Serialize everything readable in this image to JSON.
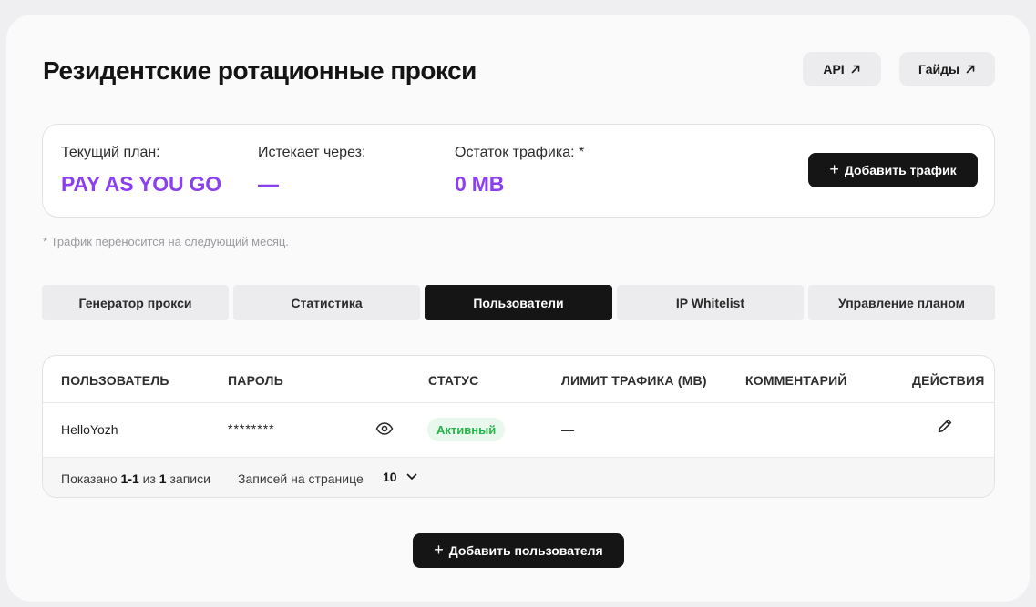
{
  "page": {
    "title": "Резидентские ротационные прокси"
  },
  "header": {
    "api_label": "API",
    "guides_label": "Гайды"
  },
  "plan": {
    "current_label": "Текущий план:",
    "current_value": "PAY AS YOU GO",
    "expires_label": "Истекает через:",
    "expires_value": "—",
    "traffic_label": "Остаток трафика: *",
    "traffic_value": "0 MB",
    "add_traffic_label": "Добавить трафик",
    "footnote": "* Трафик переносится на следующий месяц."
  },
  "tabs": [
    {
      "label": "Генератор прокси",
      "active": false
    },
    {
      "label": "Статистика",
      "active": false
    },
    {
      "label": "Пользователи",
      "active": true
    },
    {
      "label": "IP Whitelist",
      "active": false
    },
    {
      "label": "Управление планом",
      "active": false
    }
  ],
  "table": {
    "columns": [
      "ПОЛЬЗОВАТЕЛЬ",
      "ПАРОЛЬ",
      "СТАТУС",
      "ЛИМИТ ТРАФИКА (MB)",
      "КОММЕНТАРИЙ",
      "ДЕЙСТВИЯ"
    ],
    "rows": [
      {
        "user": "HelloYozh",
        "password": "********",
        "status": "Активный",
        "limit": "—",
        "comment": ""
      }
    ],
    "footer": {
      "shown_prefix": "Показано",
      "shown_range": "1-1",
      "shown_of": "из",
      "shown_total": "1",
      "shown_suffix": "записи",
      "per_page_label": "Записей на странице",
      "per_page_value": "10"
    }
  },
  "actions": {
    "add_user_label": "Добавить пользователя"
  },
  "colors": {
    "accent": "#8a3ff0",
    "dark_button": "#151515",
    "status_active": "#27b34a"
  },
  "icons": {
    "external_link": "arrow-up-right-icon",
    "plus": "plus-icon",
    "eye": "eye-icon",
    "edit": "pencil-icon",
    "chevron": "chevron-down-icon"
  }
}
